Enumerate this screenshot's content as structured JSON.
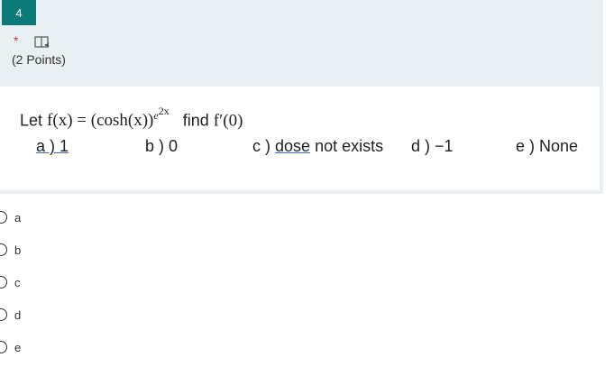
{
  "question": {
    "number": "4",
    "required_mark": "*",
    "points": "(2 Points)",
    "stem_prefix": "Let",
    "stem_function": "f(x) = (cosh(x))",
    "stem_exponent": "e",
    "stem_exponent_sup": "2x",
    "stem_suffix": "find",
    "stem_target": "f′(0)",
    "options_text": [
      {
        "label": "a ) 1"
      },
      {
        "label": "b ) 0"
      },
      {
        "prefix": "c )",
        "underlined": "dose",
        "suffix": "not exists"
      },
      {
        "label": "d ) −1"
      },
      {
        "label": "e ) None"
      }
    ]
  },
  "choices": [
    {
      "label": "a"
    },
    {
      "label": "b"
    },
    {
      "label": "c"
    },
    {
      "label": "d"
    },
    {
      "label": "e"
    }
  ],
  "colors": {
    "accent": "#0b7a78",
    "header_bg": "#e8f0f4",
    "required": "#c4314b"
  },
  "icons": {
    "reader": "immersive-reader-icon"
  }
}
